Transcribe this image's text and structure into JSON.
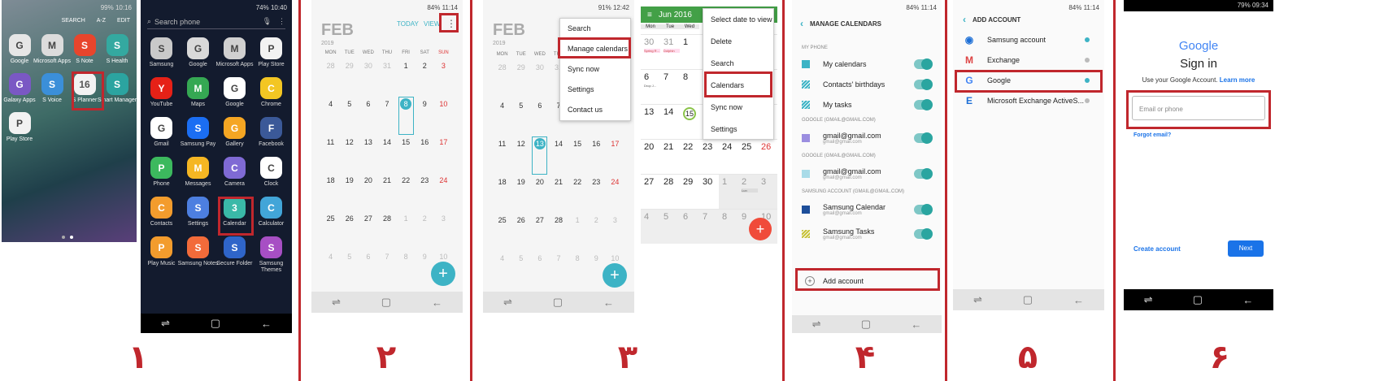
{
  "colors": {
    "accent_red": "#c0272d",
    "teal": "#2aa5a0",
    "calendar_teal": "#3db3c5",
    "google_blue": "#1a73e8",
    "green_header": "#43a047"
  },
  "steps": [
    "۱",
    "۲",
    "۳",
    "۴",
    "۵",
    "۶"
  ],
  "panel1": {
    "status": "99% 10:16",
    "top_actions": [
      "SEARCH",
      "A-Z",
      "EDIT"
    ],
    "apps": [
      {
        "label": "Google",
        "icon": "google-folder-icon",
        "color": "#e6e6e6"
      },
      {
        "label": "Microsoft Apps",
        "icon": "microsoft-folder-icon",
        "color": "#dcdcdc"
      },
      {
        "label": "S Note",
        "icon": "s-note-icon",
        "color": "#e8452c"
      },
      {
        "label": "S Health",
        "icon": "s-health-icon",
        "color": "#34a9a0"
      },
      {
        "label": "Galaxy Apps",
        "icon": "galaxy-apps-icon",
        "color": "#7a58c4"
      },
      {
        "label": "S Voice",
        "icon": "s-voice-icon",
        "color": "#3b8fd9"
      },
      {
        "label": "S Planner",
        "icon": "s-planner-icon",
        "color": "#f2f2f2"
      },
      {
        "label": "Smart Manager",
        "icon": "smart-manager-icon",
        "color": "#2ba4a0"
      },
      {
        "label": "Play Store",
        "icon": "play-store-icon",
        "color": "#f2f2f2"
      }
    ],
    "planner_day": "16",
    "planner_dow": "THU"
  },
  "panel2": {
    "status": "74% 10:40",
    "search_placeholder": "Search phone",
    "apps": [
      {
        "label": "Samsung",
        "icon": "samsung-folder-icon",
        "color": "#c9c9c9"
      },
      {
        "label": "Google",
        "icon": "google-folder-icon",
        "color": "#d9d9d9"
      },
      {
        "label": "Microsoft Apps",
        "icon": "microsoft-folder-icon",
        "color": "#d0d0d0"
      },
      {
        "label": "Play Store",
        "icon": "play-store-icon",
        "color": "#f2f2f2"
      },
      {
        "label": "YouTube",
        "icon": "youtube-icon",
        "color": "#e62117"
      },
      {
        "label": "Maps",
        "icon": "maps-icon",
        "color": "#35a853"
      },
      {
        "label": "Google",
        "icon": "google-g-icon",
        "color": "#ffffff"
      },
      {
        "label": "Chrome",
        "icon": "chrome-icon",
        "color": "#f3c623"
      },
      {
        "label": "Gmail",
        "icon": "gmail-icon",
        "color": "#ffffff"
      },
      {
        "label": "Samsung Pay",
        "icon": "samsung-pay-icon",
        "color": "#1b6ef3"
      },
      {
        "label": "Gallery",
        "icon": "gallery-icon",
        "color": "#f5a623"
      },
      {
        "label": "Facebook",
        "icon": "facebook-icon",
        "color": "#3b5998"
      },
      {
        "label": "Phone",
        "icon": "phone-icon",
        "color": "#3cb95e"
      },
      {
        "label": "Messages",
        "icon": "messages-icon",
        "color": "#f5b623"
      },
      {
        "label": "Camera",
        "icon": "camera-icon",
        "color": "#7f6ad4"
      },
      {
        "label": "Clock",
        "icon": "clock-icon",
        "color": "#ffffff"
      },
      {
        "label": "Contacts",
        "icon": "contacts-icon",
        "color": "#f39c2d"
      },
      {
        "label": "Settings",
        "icon": "settings-icon",
        "color": "#4d7fe0"
      },
      {
        "label": "Calendar",
        "icon": "calendar-icon",
        "color": "#3ab9a8"
      },
      {
        "label": "Calculator",
        "icon": "calculator-icon",
        "color": "#42a5d8"
      },
      {
        "label": "Play Music",
        "icon": "play-music-icon",
        "color": "#f39c2d"
      },
      {
        "label": "Samsung Notes",
        "icon": "samsung-notes-icon",
        "color": "#f26b3a"
      },
      {
        "label": "Secure Folder",
        "icon": "secure-folder-icon",
        "color": "#2f65c9"
      },
      {
        "label": "Samsung Themes",
        "icon": "samsung-themes-icon",
        "color": "#a74fc4"
      }
    ],
    "calendar_icon_day": "3"
  },
  "panel3": {
    "status": "84% 11:14",
    "month": "FEB",
    "year": "2019",
    "today_label": "TODAY",
    "view_label": "VIEW",
    "weekdays": [
      "MON",
      "TUE",
      "WED",
      "THU",
      "FRI",
      "SAT",
      "SUN"
    ],
    "rows": [
      [
        "28",
        "29",
        "30",
        "31",
        "1",
        "2",
        "3"
      ],
      [
        "4",
        "5",
        "6",
        "7",
        "8",
        "9",
        "10"
      ],
      [
        "11",
        "12",
        "13",
        "14",
        "15",
        "16",
        "17"
      ],
      [
        "18",
        "19",
        "20",
        "21",
        "22",
        "23",
        "24"
      ],
      [
        "25",
        "26",
        "27",
        "28",
        "1",
        "2",
        "3"
      ],
      [
        "4",
        "5",
        "6",
        "7",
        "8",
        "9",
        "10"
      ]
    ],
    "selected_day": "8"
  },
  "panel4": {
    "status": "91% 12:42",
    "month": "FEB",
    "year": "2019",
    "weekdays": [
      "MON",
      "TUE",
      "WED",
      "THU",
      "FRI",
      "SAT",
      "SUN"
    ],
    "rows": [
      [
        "28",
        "29",
        "30",
        "31",
        "1",
        "2",
        "3"
      ],
      [
        "4",
        "5",
        "6",
        "7",
        "8",
        "9",
        "10"
      ],
      [
        "11",
        "12",
        "13",
        "14",
        "15",
        "16",
        "17"
      ],
      [
        "18",
        "19",
        "20",
        "21",
        "22",
        "23",
        "24"
      ],
      [
        "25",
        "26",
        "27",
        "28",
        "1",
        "2",
        "3"
      ],
      [
        "4",
        "5",
        "6",
        "7",
        "8",
        "9",
        "10"
      ]
    ],
    "selected_day": "13",
    "menu": [
      "Search",
      "Manage calendars",
      "Sync now",
      "Settings",
      "Contact us"
    ]
  },
  "panel5": {
    "month": "Jun 2016",
    "weekdays": [
      "Mon",
      "Tue",
      "Wed"
    ],
    "rows": [
      [
        "30",
        "31",
        "1"
      ],
      [
        "6",
        "7",
        "8"
      ],
      [
        "13",
        "14",
        "15"
      ],
      [
        "20",
        "21",
        "22",
        "23",
        "24",
        "25",
        "26"
      ],
      [
        "27",
        "28",
        "29",
        "30",
        "1",
        "2",
        "3"
      ],
      [
        "4",
        "5",
        "6",
        "7",
        "8",
        "9",
        "10"
      ]
    ],
    "events": [
      "Spring R...",
      "Dolphin",
      "Drop J..."
    ],
    "event_small": "Lun",
    "today_day": "15",
    "menu": [
      "Select date to view",
      "Delete",
      "Search",
      "Calendars",
      "Sync now",
      "Settings"
    ]
  },
  "panel6": {
    "status": "84% 11:14",
    "title": "MANAGE CALENDARS",
    "sections": [
      {
        "header": "MY PHONE",
        "items": [
          {
            "name": "My calendars",
            "sub": "",
            "color": "#3db3c5",
            "pattern": "solid"
          },
          {
            "name": "Contacts' birthdays",
            "sub": "",
            "color": "#3db3c5",
            "pattern": "striped"
          },
          {
            "name": "My tasks",
            "sub": "",
            "color": "#3db3c5",
            "pattern": "striped"
          }
        ]
      },
      {
        "header": "GOOGLE (GMAIL@GMAIL.COM)",
        "items": [
          {
            "name": "gmail@gmail.com",
            "sub": "gmail@gmail.com",
            "color": "#9b8ee0",
            "pattern": "solid"
          }
        ]
      },
      {
        "header": "GOOGLE (GMAIL@GMAIL.COM)",
        "items": [
          {
            "name": "gmail@gmail.com",
            "sub": "gmail@gmail.com",
            "color": "#a9dbe8",
            "pattern": "solid"
          }
        ]
      },
      {
        "header": "SAMSUNG ACCOUNT (GMAIL@GMAIL.COM)",
        "items": [
          {
            "name": "Samsung Calendar",
            "sub": "gmail@gmail.com",
            "color": "#1d4e9a",
            "pattern": "solid"
          },
          {
            "name": "Samsung Tasks",
            "sub": "gmail@gmail.com",
            "color": "#c7c23a",
            "pattern": "striped"
          }
        ]
      }
    ],
    "add_account": "Add account"
  },
  "panel7": {
    "status": "84% 11:14",
    "title": "ADD ACCOUNT",
    "accounts": [
      {
        "name": "Samsung account",
        "icon": "samsung-account-icon",
        "dot": "#3db3c5"
      },
      {
        "name": "Exchange",
        "icon": "exchange-icon",
        "dot": "#bbbbbb"
      },
      {
        "name": "Google",
        "icon": "google-g-icon",
        "dot": "#3db3c5"
      },
      {
        "name": "Microsoft Exchange ActiveS...",
        "icon": "exchange-activesync-icon",
        "dot": "#bbbbbb"
      }
    ]
  },
  "panel8": {
    "status": "79% 09:34",
    "logo": "Google",
    "title": "Sign in",
    "subtitle": "Use your Google Account.",
    "learn_more": "Learn more",
    "email_placeholder": "Email or phone",
    "forgot": "Forgot email?",
    "create": "Create account",
    "next": "Next"
  }
}
